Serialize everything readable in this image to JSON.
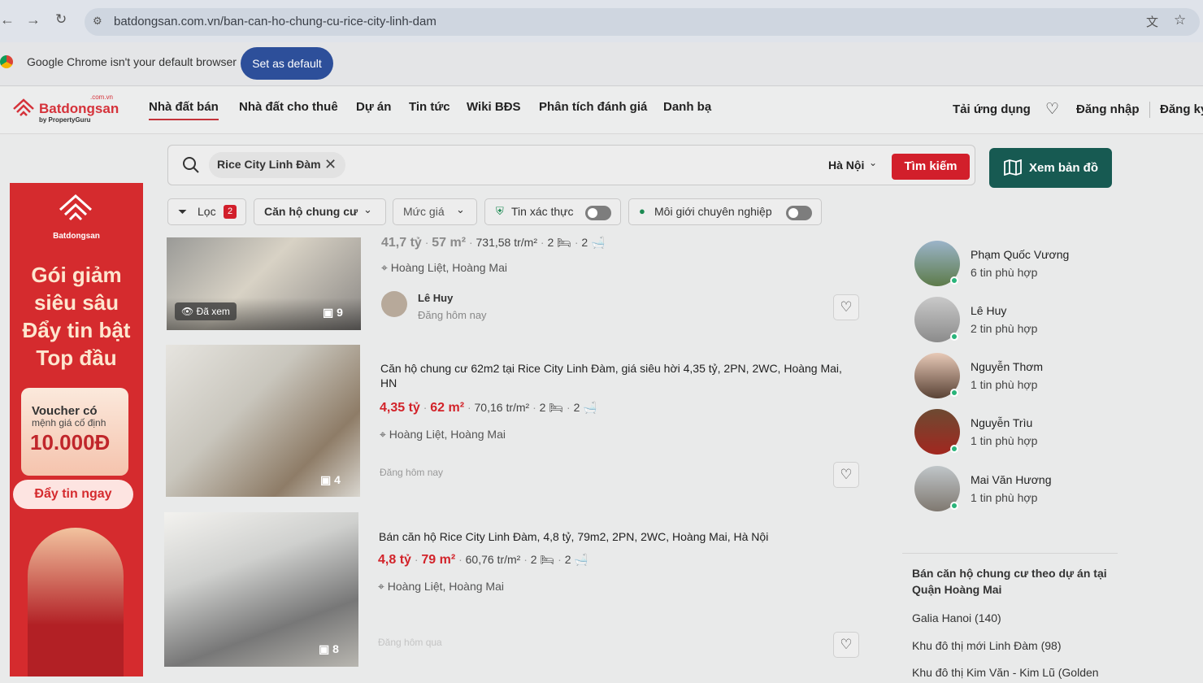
{
  "browser": {
    "url": "batdongsan.com.vn/ban-can-ho-chung-cu-rice-city-linh-dam",
    "infobar_text": "Google Chrome isn't your default browser",
    "set_default_label": "Set as default"
  },
  "header": {
    "logo_text": "Batdongsan",
    "logo_sub": "by PropertyGuru",
    "logo_domain": ".com.vn",
    "menu": [
      "Nhà đất bán",
      "Nhà đất cho thuê",
      "Dự án",
      "Tin tức",
      "Wiki BĐS",
      "Phân tích đánh giá",
      "Danh bạ"
    ],
    "app_label": "Tải ứng dụng",
    "login_label": "Đăng nhập",
    "register_label": "Đăng ký"
  },
  "search": {
    "chip_text": "Rice City Linh Đàm",
    "city": "Hà Nội",
    "search_label": "Tìm kiếm",
    "map_label": "Xem bản đồ"
  },
  "filters": {
    "filter_label": "Lọc",
    "filter_count": "2",
    "type_label": "Căn hộ chung cư",
    "price_label": "Mức giá",
    "verified_label": "Tin xác thực",
    "pro_label": "Môi giới chuyên nghiệp"
  },
  "ad": {
    "brand": "Batdongsan",
    "headline": "Gói giảm siêu sâu Đẩy tin bật Top đầu",
    "voucher_title": "Voucher có",
    "voucher_sub": "mệnh giá cố định",
    "voucher_value": "10.000Đ",
    "cta": "Đẩy tin ngay"
  },
  "listings": [
    {
      "price": "41,7 tỷ",
      "area": "57 m²",
      "ppm": "731,58 tr/m²",
      "beds": "2",
      "baths": "2",
      "location": "Hoàng Liệt, Hoàng Mai",
      "agent": "Lê Huy",
      "posted": "Đăng hôm nay",
      "photos": "9",
      "seen": "Đã xem"
    },
    {
      "title": "Căn hộ chung cư 62m2 tại Rice City Linh Đàm, giá siêu hời 4,35 tỷ, 2PN, 2WC, Hoàng Mai, HN",
      "price": "4,35 tỷ",
      "area": "62 m²",
      "ppm": "70,16 tr/m²",
      "beds": "2",
      "baths": "2",
      "location": "Hoàng Liệt, Hoàng Mai",
      "posted": "Đăng hôm nay",
      "photos": "4"
    },
    {
      "title": "Bán căn hộ Rice City Linh Đàm, 4,8 tỷ, 79m2, 2PN, 2WC, Hoàng Mai, Hà Nội",
      "price": "4,8 tỷ",
      "area": "79 m²",
      "ppm": "60,76 tr/m²",
      "beds": "2",
      "baths": "2",
      "location": "Hoàng Liệt, Hoàng Mai",
      "posted": "Đăng hôm qua",
      "photos": "8"
    }
  ],
  "agents": [
    {
      "name": "Phạm Quốc Vương",
      "count": "6 tin phù hợp"
    },
    {
      "name": "Lê Huy",
      "count": "2 tin phù hợp"
    },
    {
      "name": "Nguyễn Thơm",
      "count": "1 tin phù hợp"
    },
    {
      "name": "Nguyễn Trìu",
      "count": "1 tin phù hợp"
    },
    {
      "name": "Mai Văn Hương",
      "count": "1 tin phù hợp"
    }
  ],
  "projects": {
    "heading": "Bán căn hộ chung cư theo dự án tại Quận Hoàng Mai",
    "items": [
      "Galia Hanoi (140)",
      "Khu đô thị mới Linh Đàm (98)",
      "Khu đô thị Kim Văn - Kim Lũ (Golden"
    ]
  },
  "colors": {
    "brand_red": "#d21f2b",
    "map_green": "#175a52",
    "chrome_blue": "#2d4f9a"
  }
}
